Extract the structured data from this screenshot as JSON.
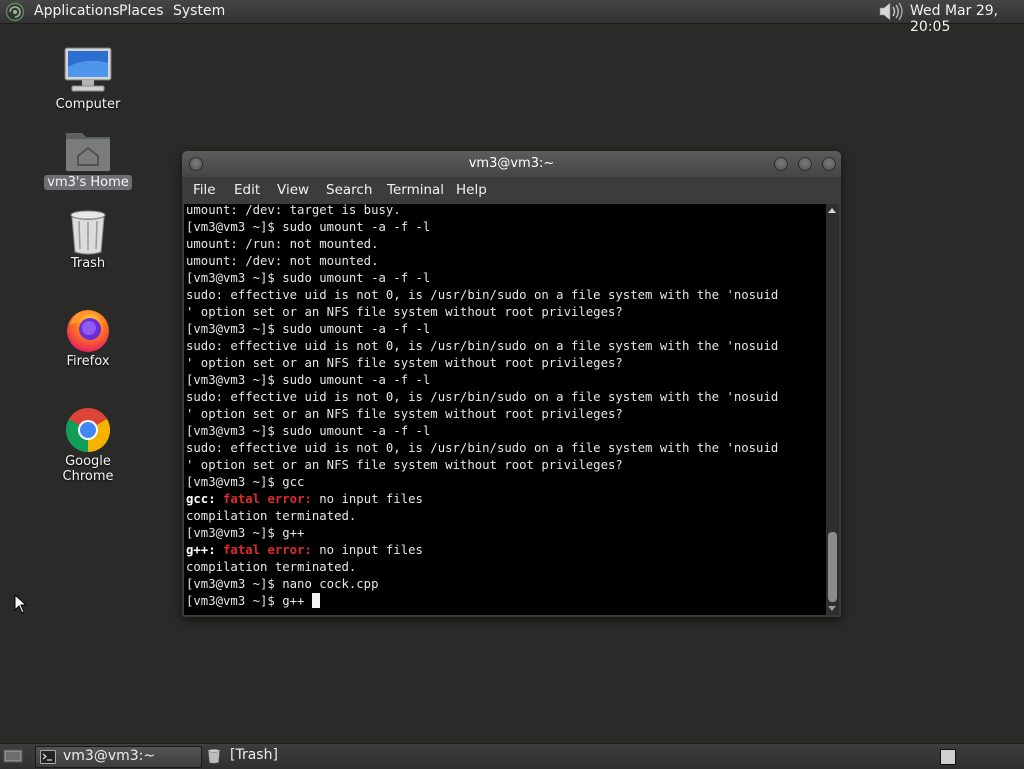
{
  "top_panel": {
    "menus": [
      "Applications",
      "Places",
      "System"
    ],
    "clock": "Wed Mar 29, 20:05",
    "icons": [
      "distro-logo-icon",
      "volume-icon"
    ]
  },
  "desktop": {
    "icons": [
      {
        "label": "Computer",
        "icon": "computer-icon",
        "selected": false
      },
      {
        "label": "vm3's Home",
        "icon": "home-folder-icon",
        "selected": true
      },
      {
        "label": "Trash",
        "icon": "trash-icon",
        "selected": false
      },
      {
        "label": "Firefox",
        "icon": "firefox-icon",
        "selected": false
      },
      {
        "label": "Google Chrome",
        "icon": "chrome-icon",
        "selected": false
      }
    ]
  },
  "terminal": {
    "title": "vm3@vm3:~",
    "menu": [
      "File",
      "Edit",
      "View",
      "Search",
      "Terminal",
      "Help"
    ],
    "lines": [
      "umount: /dev: target is busy.",
      "[vm3@vm3 ~]$ sudo umount -a -f -l",
      "umount: /run: not mounted.",
      "umount: /dev: not mounted.",
      "[vm3@vm3 ~]$ sudo umount -a -f -l",
      "sudo: effective uid is not 0, is /usr/bin/sudo on a file system with the 'nosuid",
      "' option set or an NFS file system without root privileges?",
      "[vm3@vm3 ~]$ sudo umount -a -f -l",
      "sudo: effective uid is not 0, is /usr/bin/sudo on a file system with the 'nosuid",
      "' option set or an NFS file system without root privileges?",
      "[vm3@vm3 ~]$ sudo umount -a -f -l",
      "sudo: effective uid is not 0, is /usr/bin/sudo on a file system with the 'nosuid",
      "' option set or an NFS file system without root privileges?",
      "[vm3@vm3 ~]$ sudo umount -a -f -l",
      "sudo: effective uid is not 0, is /usr/bin/sudo on a file system with the 'nosuid",
      "' option set or an NFS file system without root privileges?",
      "[vm3@vm3 ~]$ gcc",
      "compilation terminated.",
      "[vm3@vm3 ~]$ g++",
      "compilation terminated.",
      "[vm3@vm3 ~]$ nano cock.cpp"
    ],
    "errors": [
      {
        "prog": "gcc",
        "sep": ":",
        "label": "fatal error:",
        "msg": " no input files"
      },
      {
        "prog": "g++",
        "sep": ":",
        "label": "fatal error:",
        "msg": " no input files"
      }
    ],
    "prompt": "[vm3@vm3 ~]$ ",
    "current_input": "g++ "
  },
  "bottom_panel": {
    "tasks": [
      {
        "label": "vm3@vm3:~",
        "icon": "terminal-icon",
        "active": true
      },
      {
        "label": "[Trash]",
        "icon": "trash-icon",
        "active": false
      }
    ]
  },
  "colors": {
    "desktop_bg": "#2a2b28",
    "terminal_bg": "#000000",
    "error_red": "#e02b2b"
  }
}
